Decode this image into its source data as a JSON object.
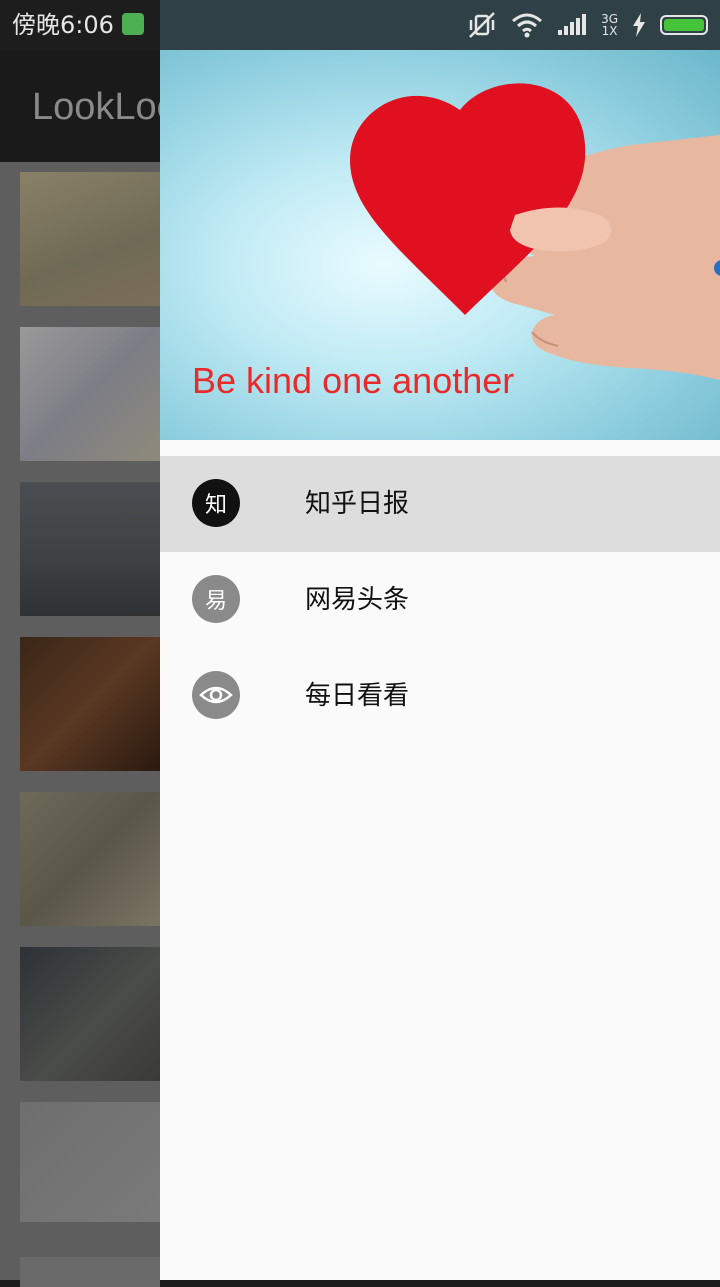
{
  "status_bar": {
    "time": "傍晚6:06",
    "network_type": "3G",
    "sim_label": "1X"
  },
  "background_app": {
    "title": "LookLook"
  },
  "drawer": {
    "header_text": "Be kind one another",
    "menu": [
      {
        "label": "知乎日报",
        "icon_text": "知",
        "icon": "zhihu-icon",
        "active": true
      },
      {
        "label": "网易头条",
        "icon_text": "易",
        "icon": "netease-icon",
        "active": false
      },
      {
        "label": "每日看看",
        "icon": "eye-icon",
        "active": false
      }
    ]
  },
  "colors": {
    "header_text": "#e82a2a",
    "active_item_bg": "#dddddd",
    "battery_fill": "#45c43a"
  }
}
